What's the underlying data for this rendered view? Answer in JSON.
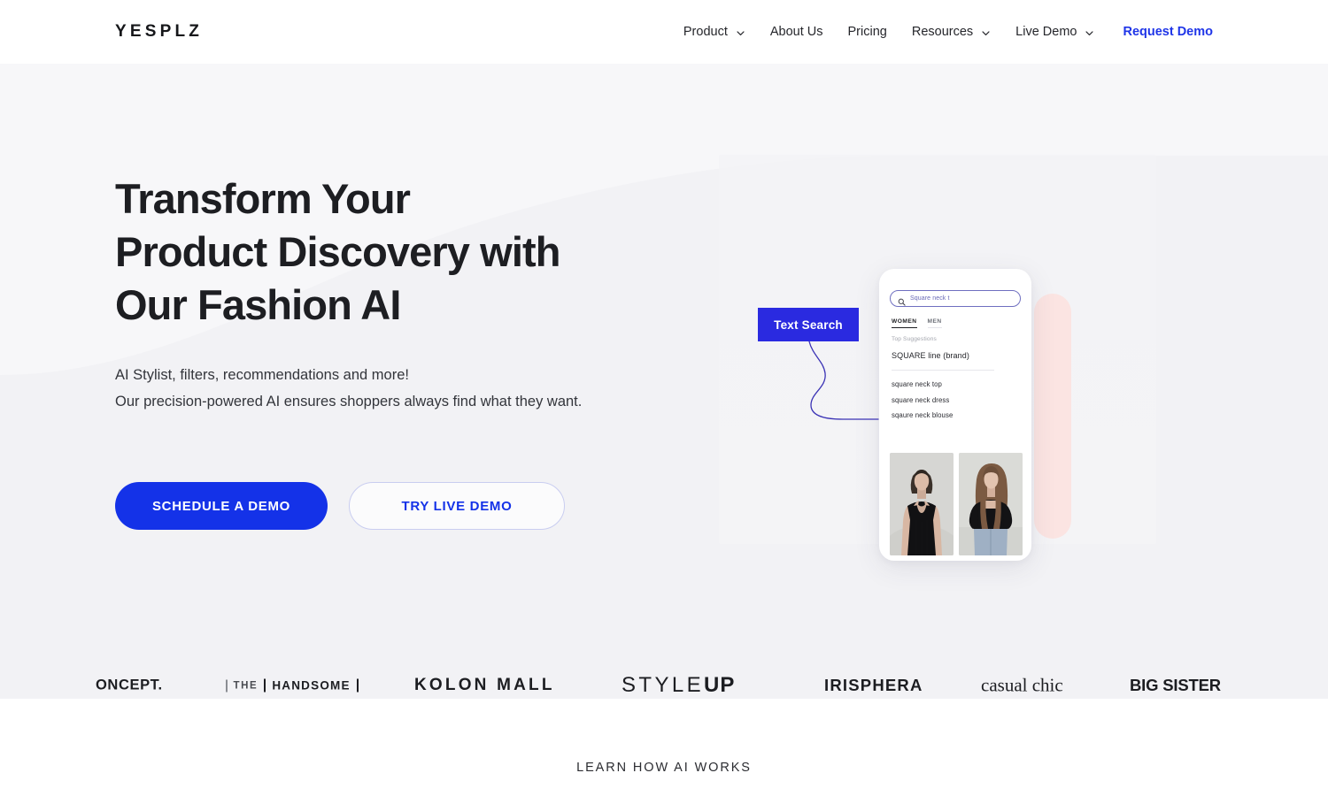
{
  "header": {
    "brand": "YESPLZ",
    "nav_items": [
      {
        "label": "Product",
        "has_dropdown": true,
        "cta": false
      },
      {
        "label": "About Us",
        "has_dropdown": false,
        "cta": false
      },
      {
        "label": "Pricing",
        "has_dropdown": false,
        "cta": false
      },
      {
        "label": "Resources",
        "has_dropdown": true,
        "cta": false
      },
      {
        "label": "Live Demo",
        "has_dropdown": true,
        "cta": false
      },
      {
        "label": "Request Demo",
        "has_dropdown": false,
        "cta": true
      }
    ]
  },
  "hero": {
    "headline_line1": "Transform Your",
    "headline_line2": "Product Discovery with",
    "headline_line3": "Our Fashion AI",
    "subhead_line1": "AI Stylist, filters, recommendations and more!",
    "subhead_line2": "Our precision-powered AI ensures shoppers always find what they want.",
    "primary_cta": "SCHEDULE A DEMO",
    "secondary_cta": "TRY LIVE DEMO"
  },
  "mockup": {
    "badge_label": "Text Search",
    "search_value": "Square neck t",
    "search_icon": "search-icon",
    "tabs": [
      {
        "label": "WOMEN",
        "active": true
      },
      {
        "label": "MEN",
        "active": false
      }
    ],
    "suggestions_label": "Top Suggestions",
    "brand_suggestion": "SQUARE line (brand)",
    "suggestions": [
      "square neck top",
      "square neck dress",
      "sqaure neck blouse"
    ],
    "results": [
      {
        "alt": "model wearing black ribbed tank top"
      },
      {
        "alt": "model wearing black square neck knit top with jeans"
      }
    ]
  },
  "logos": [
    {
      "name": "oncept",
      "text": "ONCEPT."
    },
    {
      "name": "handsome",
      "text": "THE",
      "text2": "HANDSOME"
    },
    {
      "name": "kolonmall",
      "text": "KOLON MALL"
    },
    {
      "name": "styleup",
      "text": "STYLE",
      "text2": "UP"
    },
    {
      "name": "irisphera",
      "text": "IRISPHERA"
    },
    {
      "name": "casualchic",
      "text": "casual chic"
    },
    {
      "name": "bigsister",
      "text": "BIG",
      "text2": "SISTER"
    }
  ],
  "footer": {
    "learn_link": "LEARN HOW AI WORKS"
  },
  "colors": {
    "brand_blue": "#1432e8",
    "badge_blue": "#2a2ae0",
    "hero_bg": "#f7f7f9",
    "pink_blob": "#fbe4e2",
    "text_dark": "#1d1e22"
  }
}
